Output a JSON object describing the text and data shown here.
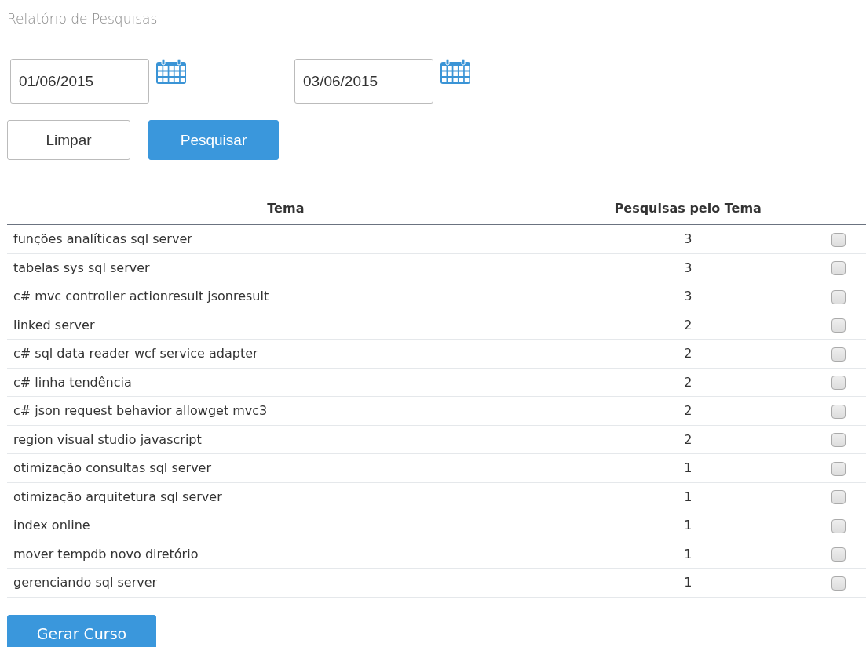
{
  "title": "Relatório de Pesquisas",
  "date_from": {
    "value": "01/06/2015"
  },
  "date_to": {
    "value": "03/06/2015"
  },
  "buttons": [
    {
      "label": "Limpar",
      "kind": "default"
    },
    {
      "label": "Pesquisar",
      "kind": "primary"
    }
  ],
  "table": {
    "columns": [
      "Tema",
      "Pesquisas pelo Tema"
    ],
    "rows": [
      {
        "tema": "funções analíticas sql server",
        "count": "3",
        "checked": false
      },
      {
        "tema": "tabelas sys sql server",
        "count": "3",
        "checked": false
      },
      {
        "tema": "c# mvc controller actionresult jsonresult",
        "count": "3",
        "checked": false
      },
      {
        "tema": "linked server",
        "count": "2",
        "checked": false
      },
      {
        "tema": "c# sql data reader wcf service adapter",
        "count": "2",
        "checked": false
      },
      {
        "tema": "c# linha tendência",
        "count": "2",
        "checked": false
      },
      {
        "tema": "c# json request behavior allowget mvc3",
        "count": "2",
        "checked": false
      },
      {
        "tema": "region visual studio javascript",
        "count": "2",
        "checked": false
      },
      {
        "tema": "otimização consultas sql server",
        "count": "1",
        "checked": false
      },
      {
        "tema": "otimização arquitetura sql server",
        "count": "1",
        "checked": false
      },
      {
        "tema": "index online",
        "count": "1",
        "checked": false
      },
      {
        "tema": "mover tempdb novo diretório",
        "count": "1",
        "checked": false
      },
      {
        "tema": "gerenciando sql server",
        "count": "1",
        "checked": false
      }
    ]
  },
  "generate_button": {
    "label": "Gerar Curso"
  }
}
